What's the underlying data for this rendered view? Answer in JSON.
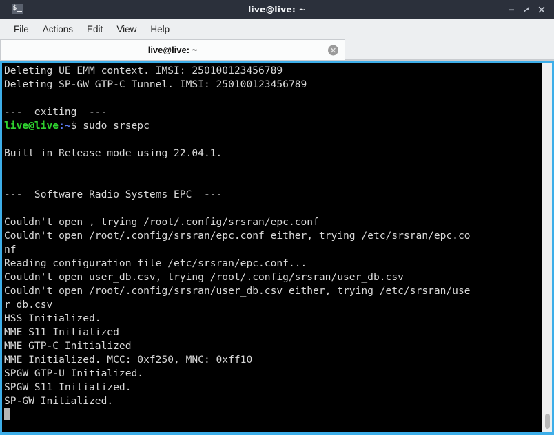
{
  "window": {
    "title": "live@live: ~",
    "app_icon": "terminal-icon",
    "controls": {
      "minimize": "minimize-icon",
      "maximize": "maximize-icon",
      "close": "close-icon"
    }
  },
  "menubar": {
    "items": [
      {
        "label": "File"
      },
      {
        "label": "Actions"
      },
      {
        "label": "Edit"
      },
      {
        "label": "View"
      },
      {
        "label": "Help"
      }
    ]
  },
  "tabbar": {
    "tabs": [
      {
        "label": "live@live: ~",
        "close_icon": "close-circle-icon",
        "active": true
      }
    ]
  },
  "terminal": {
    "colors": {
      "background": "#000000",
      "foreground": "#d8d8d8",
      "prompt_user": "#2fd32f",
      "prompt_path": "#5c7cf5",
      "border": "#3daee9",
      "cursor": "#b4b4b4"
    },
    "lines": [
      {
        "segments": [
          {
            "text": "Deleting UE EMM context. IMSI: 250100123456789",
            "cls": "cw"
          }
        ]
      },
      {
        "segments": [
          {
            "text": "Deleting SP-GW GTP-C Tunnel. IMSI: 250100123456789",
            "cls": "cw"
          }
        ]
      },
      {
        "segments": [
          {
            "text": "",
            "cls": "cw"
          }
        ]
      },
      {
        "segments": [
          {
            "text": "---  exiting  ---",
            "cls": "cw"
          }
        ]
      },
      {
        "segments": [
          {
            "text": "live@live",
            "cls": "cg"
          },
          {
            "text": ":~",
            "cls": "cb"
          },
          {
            "text": "$ sudo srsepc",
            "cls": "cw"
          }
        ]
      },
      {
        "segments": [
          {
            "text": "",
            "cls": "cw"
          }
        ]
      },
      {
        "segments": [
          {
            "text": "Built in Release mode using 22.04.1.",
            "cls": "cw"
          }
        ]
      },
      {
        "segments": [
          {
            "text": "",
            "cls": "cw"
          }
        ]
      },
      {
        "segments": [
          {
            "text": "",
            "cls": "cw"
          }
        ]
      },
      {
        "segments": [
          {
            "text": "---  Software Radio Systems EPC  ---",
            "cls": "cw"
          }
        ]
      },
      {
        "segments": [
          {
            "text": "",
            "cls": "cw"
          }
        ]
      },
      {
        "segments": [
          {
            "text": "Couldn't open , trying /root/.config/srsran/epc.conf",
            "cls": "cw"
          }
        ]
      },
      {
        "segments": [
          {
            "text": "Couldn't open /root/.config/srsran/epc.conf either, trying /etc/srsran/epc.co",
            "cls": "cw"
          }
        ]
      },
      {
        "segments": [
          {
            "text": "nf",
            "cls": "cw"
          }
        ]
      },
      {
        "segments": [
          {
            "text": "Reading configuration file /etc/srsran/epc.conf...",
            "cls": "cw"
          }
        ]
      },
      {
        "segments": [
          {
            "text": "Couldn't open user_db.csv, trying /root/.config/srsran/user_db.csv",
            "cls": "cw"
          }
        ]
      },
      {
        "segments": [
          {
            "text": "Couldn't open /root/.config/srsran/user_db.csv either, trying /etc/srsran/use",
            "cls": "cw"
          }
        ]
      },
      {
        "segments": [
          {
            "text": "r_db.csv",
            "cls": "cw"
          }
        ]
      },
      {
        "segments": [
          {
            "text": "HSS Initialized.",
            "cls": "cw"
          }
        ]
      },
      {
        "segments": [
          {
            "text": "MME S11 Initialized",
            "cls": "cw"
          }
        ]
      },
      {
        "segments": [
          {
            "text": "MME GTP-C Initialized",
            "cls": "cw"
          }
        ]
      },
      {
        "segments": [
          {
            "text": "MME Initialized. MCC: 0xf250, MNC: 0xff10",
            "cls": "cw"
          }
        ]
      },
      {
        "segments": [
          {
            "text": "SPGW GTP-U Initialized.",
            "cls": "cw"
          }
        ]
      },
      {
        "segments": [
          {
            "text": "SPGW S11 Initialized.",
            "cls": "cw"
          }
        ]
      },
      {
        "segments": [
          {
            "text": "SP-GW Initialized.",
            "cls": "cw"
          }
        ]
      },
      {
        "segments": [],
        "cursor": true
      }
    ]
  },
  "scrollbar": {
    "orientation": "vertical",
    "thumb_position": "bottom"
  }
}
